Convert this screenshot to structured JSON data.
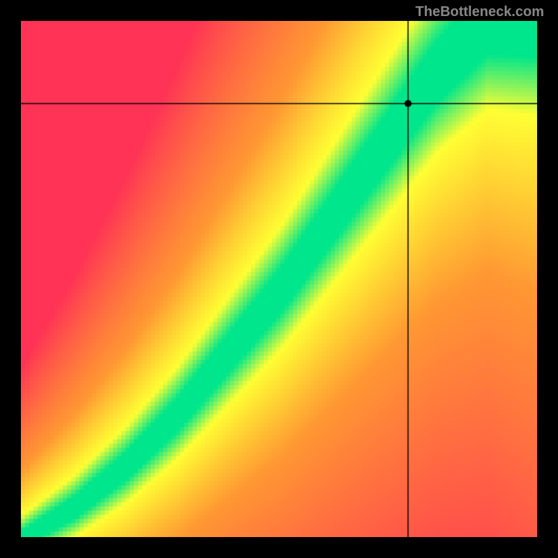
{
  "watermark": "TheBottleneck.com",
  "chart_data": {
    "type": "heatmap",
    "title": "",
    "xlabel": "",
    "ylabel": "",
    "xlim": [
      0,
      100
    ],
    "ylim": [
      0,
      100
    ],
    "crosshair": {
      "x": 75,
      "y": 84
    },
    "marker": {
      "x": 75,
      "y": 84
    },
    "optimal_curve": [
      {
        "x": 0,
        "y": 0
      },
      {
        "x": 10,
        "y": 6
      },
      {
        "x": 20,
        "y": 14
      },
      {
        "x": 30,
        "y": 24
      },
      {
        "x": 40,
        "y": 36
      },
      {
        "x": 50,
        "y": 48
      },
      {
        "x": 60,
        "y": 62
      },
      {
        "x": 70,
        "y": 76
      },
      {
        "x": 80,
        "y": 90
      },
      {
        "x": 90,
        "y": 100
      }
    ],
    "color_scale": {
      "optimal": "#00e68c",
      "near": "#ffff33",
      "moderate": "#ff9933",
      "far": "#ff3355"
    },
    "colors": {
      "crosshair": "#000000",
      "marker_fill": "#000000",
      "background": "#000000"
    }
  }
}
